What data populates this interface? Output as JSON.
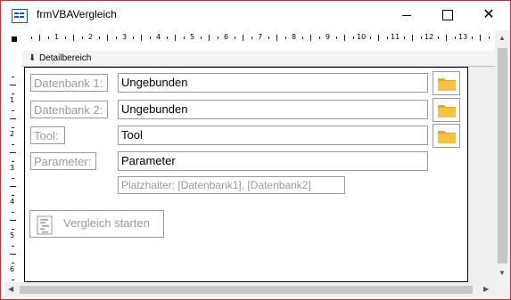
{
  "window": {
    "title": "frmVBAVergleich",
    "minimize_label": "—",
    "close_label": "✕"
  },
  "ruler": {
    "h_numbers": [
      "1",
      "2",
      "3",
      "4",
      "5",
      "6",
      "7",
      "8",
      "9",
      "10",
      "11",
      "12",
      "13"
    ],
    "v_numbers": [
      "1",
      "2",
      "3",
      "4",
      "5",
      "6"
    ]
  },
  "section": {
    "label": "Detailbereich",
    "icon": "arrow-down-icon"
  },
  "form": {
    "label_db1": "Datenbank 1:",
    "field_db1": "Ungebunden",
    "label_db2": "Datenbank 2:",
    "field_db2": "Ungebunden",
    "label_tool": "Tool:",
    "field_tool": "Tool",
    "label_param": "Parameter:",
    "field_param": "Parameter",
    "hint": "Platzhalter: [Datenbank1], [Datenbank2]",
    "start_label": "Vergleich starten"
  },
  "icons": {
    "folder": "folder-icon",
    "start": "code-icon"
  },
  "colors": {
    "window_border": "#b53a3a",
    "disabled_text": "#9a9a9a",
    "folder_yellow": "#f6c244"
  }
}
